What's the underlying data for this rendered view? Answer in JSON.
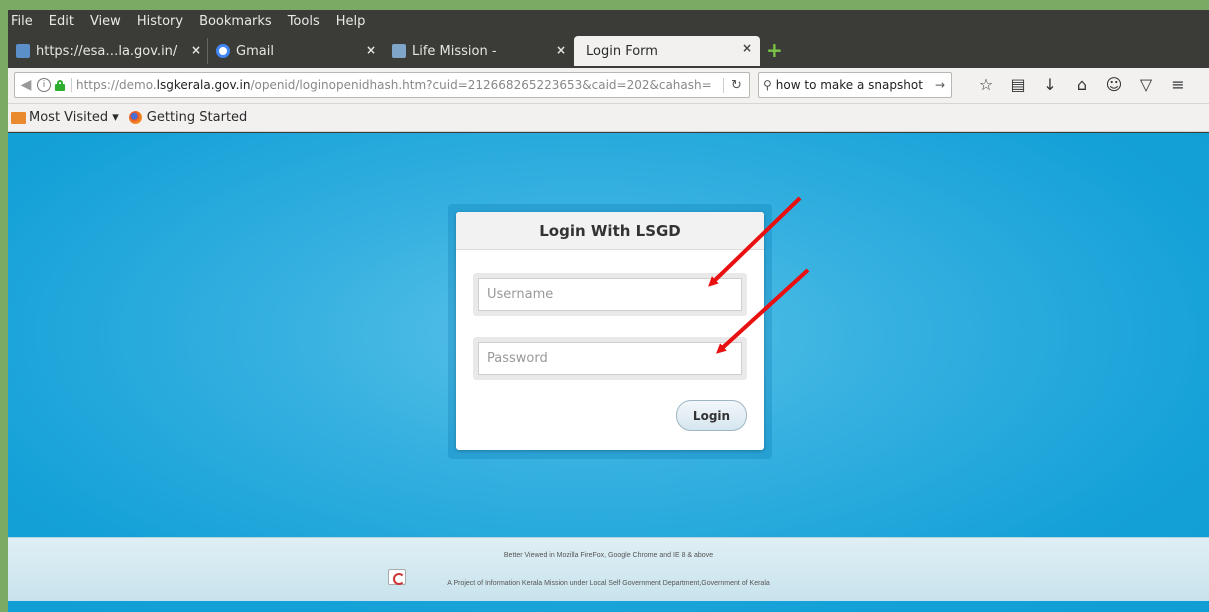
{
  "menubar": {
    "items": [
      "File",
      "Edit",
      "View",
      "History",
      "Bookmarks",
      "Tools",
      "Help"
    ]
  },
  "tabs": [
    {
      "title": "https://esa…la.gov.in/",
      "close": "×"
    },
    {
      "title": "Gmail",
      "close": "×"
    },
    {
      "title": "Life Mission -",
      "close": "×"
    },
    {
      "title": "Login Form",
      "close": "×"
    }
  ],
  "new_tab": "+",
  "navbar": {
    "url_prefix": "https://demo.",
    "url_host": "lsgkerala.gov.in",
    "url_path": "/openid/loginopenidhash.htm?cuid=212668265223653&caid=202&cahash=",
    "search_value": "how to make a snapshot"
  },
  "bookmarks": {
    "most_visited": "Most Visited ▾",
    "getting_started": "Getting Started"
  },
  "login": {
    "title": "Login With LSGD",
    "username_placeholder": "Username",
    "password_placeholder": "Password",
    "button": "Login"
  },
  "footer": {
    "line1": "Better Viewed in Mozilla FireFox, Google Chrome and IE 8 & above",
    "line2": "A Project of Information Kerala Mission under Local Self Government Department,Government of Kerala"
  },
  "colors": {
    "annotation_arrow": "#e81010",
    "content_bg": "#14a1d7",
    "desktop_bg": "#7aaa63"
  }
}
